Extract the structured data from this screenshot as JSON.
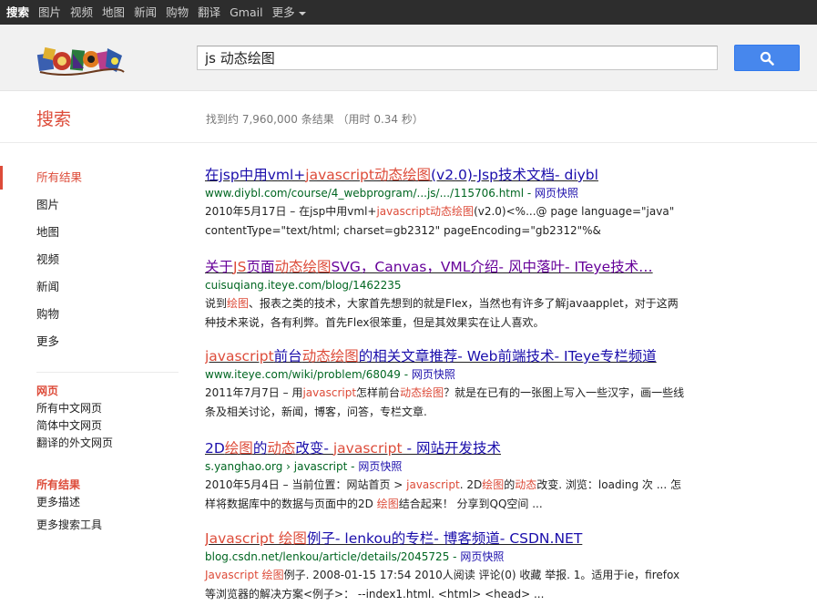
{
  "topbar": {
    "items": [
      "搜索",
      "图片",
      "视频",
      "地图",
      "新闻",
      "购物",
      "翻译",
      "Gmail",
      "更多"
    ]
  },
  "search": {
    "query": "js 动态绘图"
  },
  "subheader": {
    "title": "搜索",
    "stats": "找到约 7,960,000 条结果 （用时 0.34 秒）"
  },
  "leftnav": {
    "items": [
      "所有结果",
      "图片",
      "地图",
      "视频",
      "新闻",
      "购物",
      "更多"
    ],
    "group1": {
      "heading": "网页",
      "links": [
        "所有中文网页",
        "简体中文网页",
        "翻译的外文网页"
      ]
    },
    "group2": {
      "heading": "所有结果",
      "links": [
        "更多描述"
      ]
    },
    "tools": "更多搜索工具"
  },
  "results": [
    {
      "title": [
        [
          "在jsp中用vml+",
          false
        ],
        [
          "javascript动态绘图",
          true
        ],
        [
          "(v2.0)-Jsp技术文档- diybl",
          false
        ]
      ],
      "url": "www.diybl.com/course/4_webprogram/...js/.../115706.html",
      "cache": "网页快照",
      "snippet": [
        [
          "2010年5月17日 – 在jsp中用vml+",
          false
        ],
        [
          "javascript动态绘图",
          true
        ],
        [
          "(v2.0)<%...@ page language=\"java\" contentType=\"text/html; charset=gb2312\" pageEncoding=\"gb2312\"%&",
          false
        ]
      ],
      "visited": false
    },
    {
      "title": [
        [
          "关于",
          false
        ],
        [
          "JS",
          true
        ],
        [
          "页面",
          false
        ],
        [
          "动态绘图",
          true
        ],
        [
          "SVG，Canvas，VML介绍- 风中落叶- ITeye技术…",
          false
        ]
      ],
      "url": "cuisuqiang.iteye.com/blog/1462235",
      "cache": "",
      "snippet": [
        [
          "说到",
          false
        ],
        [
          "绘图",
          true
        ],
        [
          "、报表之类的技术，大家首先想到的就是Flex，当然也有许多了解javaapplet，对于这两种技术来说，各有利弊。首先Flex很笨重，但是其效果实在让人喜欢。",
          false
        ]
      ],
      "visited": true
    },
    {
      "title": [
        [
          "javascript",
          true
        ],
        [
          "前台",
          false
        ],
        [
          "动态绘图",
          true
        ],
        [
          "的相关文章推荐- Web前端技术- ITeye专栏频道",
          false
        ]
      ],
      "url": "www.iteye.com/wiki/problem/68049",
      "cache": "网页快照",
      "snippet": [
        [
          "2011年7月7日 – 用",
          false
        ],
        [
          "javascript",
          true
        ],
        [
          "怎样前台",
          false
        ],
        [
          "动态绘图",
          true
        ],
        [
          "？就是在已有的一张图上写入一些汉字，画一些线条及相关讨论，新闻，博客，问答，专栏文章.",
          false
        ]
      ],
      "visited": false
    },
    {
      "title": [
        [
          "2D",
          false
        ],
        [
          "绘图",
          true
        ],
        [
          "的",
          false
        ],
        [
          "动态",
          true
        ],
        [
          "改变- ",
          false
        ],
        [
          "javascript",
          true
        ],
        [
          " - 网站开发技术",
          false
        ]
      ],
      "url": "s.yanghao.org › javascript",
      "cache": "网页快照",
      "snippet": [
        [
          "2010年5月4日 – 当前位置：网站首页 > ",
          false
        ],
        [
          "javascript",
          true
        ],
        [
          ". 2D",
          false
        ],
        [
          "绘图",
          true
        ],
        [
          "的",
          false
        ],
        [
          "动态",
          true
        ],
        [
          "改变. 浏览：loading 次 ... 怎样将数据库中的数据与页面中的2D ",
          false
        ],
        [
          "绘图",
          true
        ],
        [
          "结合起来！ 分享到QQ空间 ...",
          false
        ]
      ],
      "visited": false
    },
    {
      "title": [
        [
          "Javascript 绘图",
          true
        ],
        [
          "例子- lenkou的专栏- 博客频道- CSDN.NET",
          false
        ]
      ],
      "url": "blog.csdn.net/lenkou/article/details/2045725",
      "cache": "网页快照",
      "snippet": [
        [
          "Javascript 绘图",
          true
        ],
        [
          "例子. 2008-01-15 17:54 2010人阅读 评论(0) 收藏 举报. 1。适用于ie，firefox等浏览器的解决方案<例子>： --index1.html. <html> <head> ...",
          false
        ]
      ],
      "visited": false
    }
  ],
  "colors": {
    "link": "#1a0dab",
    "visited": "#660099",
    "highlight": "#dd4b39",
    "url": "#006621",
    "button": "#4787ed"
  }
}
